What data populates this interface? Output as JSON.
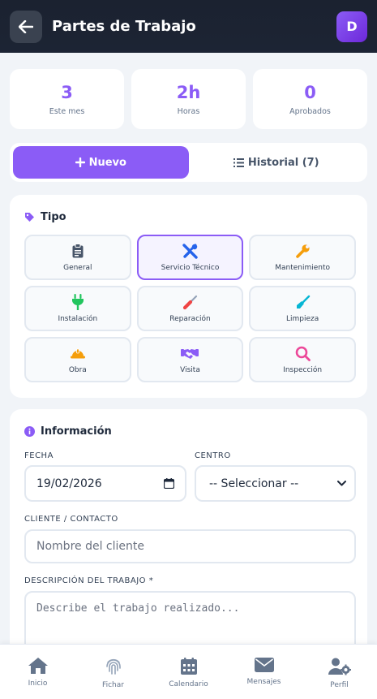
{
  "header": {
    "title": "Partes de Trabajo",
    "avatar_initial": "D"
  },
  "stats": [
    {
      "value": "3",
      "label": "Este mes"
    },
    {
      "value": "2h",
      "label": "Horas"
    },
    {
      "value": "0",
      "label": "Aprobados"
    }
  ],
  "tabs": {
    "new_label": "Nuevo",
    "history_label": "Historial (7)"
  },
  "tipo": {
    "title": "Tipo",
    "types": [
      {
        "label": "General",
        "icon": "clipboard-icon",
        "color": "#475569"
      },
      {
        "label": "Servicio Técnico",
        "icon": "tools-icon",
        "color": "#2563eb",
        "selected": true
      },
      {
        "label": "Mantenimiento",
        "icon": "wrench-icon",
        "color": "#f59e0b"
      },
      {
        "label": "Instalación",
        "icon": "plug-icon",
        "color": "#22c55e"
      },
      {
        "label": "Reparación",
        "icon": "screwdriver-icon",
        "color": "#ef4444"
      },
      {
        "label": "Limpieza",
        "icon": "broom-icon",
        "color": "#06b6d4"
      },
      {
        "label": "Obra",
        "icon": "hard-hat-icon",
        "color": "#f59e0b"
      },
      {
        "label": "Visita",
        "icon": "handshake-icon",
        "color": "#8b5cf6"
      },
      {
        "label": "Inspección",
        "icon": "magnifier-icon",
        "color": "#ec4899"
      }
    ]
  },
  "info": {
    "title": "Información",
    "fecha_label": "FECHA",
    "fecha_value": "19/02/2026",
    "centro_label": "CENTRO",
    "centro_value": "-- Seleccionar --",
    "cliente_label": "CLIENTE / CONTACTO",
    "cliente_placeholder": "Nombre del cliente",
    "descripcion_label": "DESCRIPCIÓN DEL TRABAJO *",
    "descripcion_placeholder": "Describe el trabajo realizado..."
  },
  "nav": [
    {
      "label": "Inicio",
      "icon": "home-icon"
    },
    {
      "label": "Fichar",
      "icon": "fingerprint-icon"
    },
    {
      "label": "Calendario",
      "icon": "calendar-icon"
    },
    {
      "label": "Mensajes",
      "icon": "envelope-icon"
    },
    {
      "label": "Perfil",
      "icon": "user-gear-icon"
    }
  ],
  "colors": {
    "accent": "#8b5cf6",
    "header_bg": "#1b2230",
    "page_bg": "#f1f4f8"
  }
}
